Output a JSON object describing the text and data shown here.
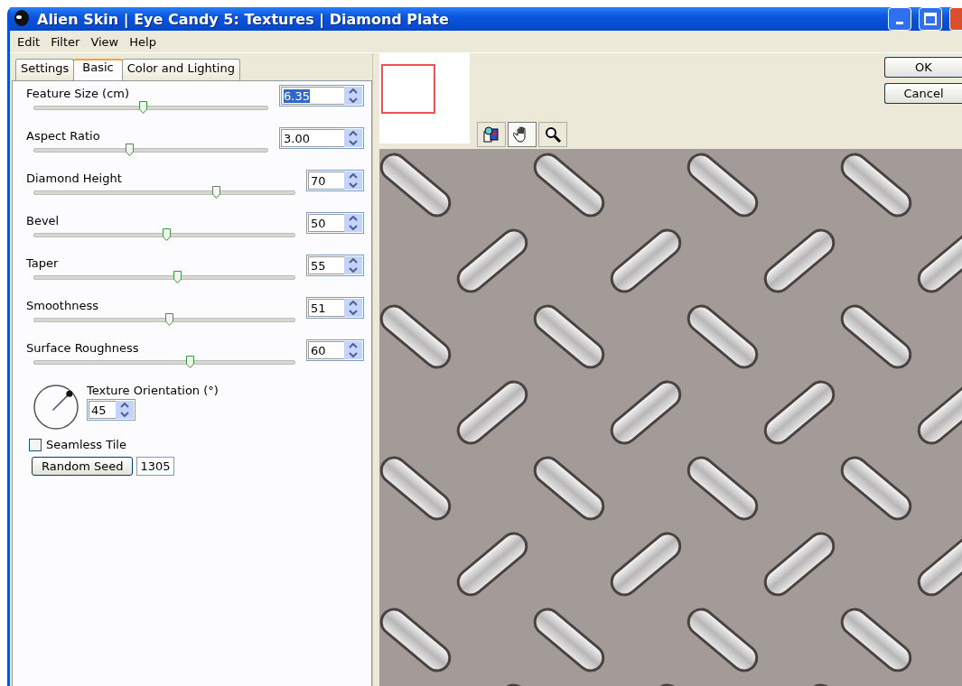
{
  "window": {
    "title": "Alien Skin | Eye Candy 5: Textures | Diamond Plate"
  },
  "menu": [
    "Edit",
    "Filter",
    "View",
    "Help"
  ],
  "tabs": [
    {
      "label": "Settings",
      "selected": false
    },
    {
      "label": "Basic",
      "selected": true
    },
    {
      "label": "Color and Lighting",
      "selected": false
    }
  ],
  "sliders": [
    {
      "label": "Feature Size (cm)",
      "value": "6.35",
      "level": 0.47,
      "wide": true,
      "focused": true
    },
    {
      "label": "Aspect Ratio",
      "value": "3.00",
      "level": 0.41,
      "wide": true,
      "focused": false
    },
    {
      "label": "Diamond Height",
      "value": "70",
      "level": 0.7,
      "wide": false,
      "focused": false
    },
    {
      "label": "Bevel",
      "value": "50",
      "level": 0.51,
      "wide": false,
      "focused": false
    },
    {
      "label": "Taper",
      "value": "55",
      "level": 0.55,
      "wide": false,
      "focused": false
    },
    {
      "label": "Smoothness",
      "value": "51",
      "level": 0.52,
      "wide": false,
      "focused": false
    },
    {
      "label": "Surface Roughness",
      "value": "60",
      "level": 0.6,
      "wide": false,
      "focused": false
    }
  ],
  "orientation": {
    "label": "Texture Orientation (°)",
    "value": "45"
  },
  "seamless_tile": {
    "label": "Seamless Tile",
    "checked": false
  },
  "random_seed": {
    "button": "Random Seed",
    "value": "1305"
  },
  "preview_tools": [
    {
      "kind": "compare",
      "selected": false
    },
    {
      "kind": "hand",
      "selected": true
    },
    {
      "kind": "zoom",
      "selected": false
    }
  ],
  "buttons": [
    "OK",
    "Cancel"
  ]
}
